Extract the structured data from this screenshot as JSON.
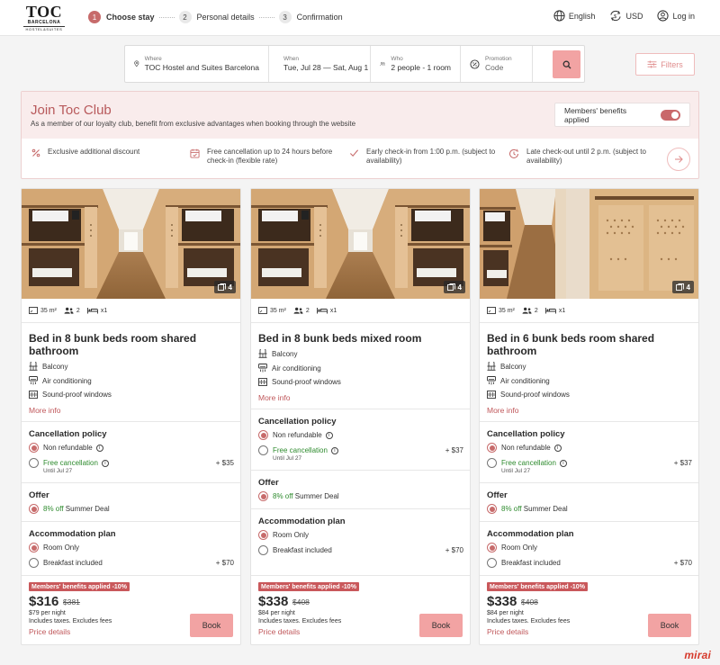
{
  "header": {
    "logo_main": "TOC",
    "logo_city": "BARCELONA",
    "logo_tagline": "HOSTEL&SUITES",
    "steps": [
      {
        "num": "1",
        "label": "Choose stay"
      },
      {
        "num": "2",
        "label": "Personal details"
      },
      {
        "num": "3",
        "label": "Confirmation"
      }
    ],
    "language": "English",
    "currency": "USD",
    "login": "Log in"
  },
  "search": {
    "where_label": "Where",
    "where_value": "TOC Hostel and Suites Barcelona",
    "when_label": "When",
    "when_value": "Tue, Jul 28 — Sat, Aug 1",
    "who_label": "Who",
    "who_value": "2 people - 1 room",
    "promo_label": "Promotion",
    "promo_placeholder": "Code",
    "filters_label": "Filters"
  },
  "club": {
    "title": "Join Toc Club",
    "subtitle": "As a member of our loyalty club, benefit from exclusive advantages when booking through the website",
    "toggle_label": "Members' benefits applied",
    "perks": [
      "Exclusive additional discount",
      "Free cancellation up to 24 hours before check-in (flexible rate)",
      "Early check-in from 1:00 p.m. (subject to availability)",
      "Late check-out until 2 p.m. (subject to availability)"
    ]
  },
  "cards": [
    {
      "photo_count": "4",
      "size": "35 m²",
      "guests": "2",
      "beds": "x1",
      "title": "Bed in 8 bunk beds room shared bathroom",
      "amenities": [
        "Balcony",
        "Air conditioning",
        "Sound-proof windows"
      ],
      "more_info": "More info",
      "cancel_title": "Cancellation policy",
      "non_refundable": "Non refundable",
      "free_cancel": "Free cancellation",
      "free_cancel_until": "Until Jul 27",
      "free_cancel_price": "+ $35",
      "offer_title": "Offer",
      "offer_pct": "8% off",
      "offer_name": "Summer Deal",
      "plan_title": "Accommodation plan",
      "room_only": "Room Only",
      "breakfast": "Breakfast included",
      "breakfast_price": "+ $70",
      "badge": "Members' benefits applied -10%",
      "price": "$316",
      "old_price": "$381",
      "per_night": "$79 per night",
      "taxes": "Includes taxes. Excludes fees",
      "price_details": "Price details",
      "book": "Book"
    },
    {
      "photo_count": "4",
      "size": "35 m²",
      "guests": "2",
      "beds": "x1",
      "title": "Bed in 8 bunk beds mixed room",
      "amenities": [
        "Balcony",
        "Air conditioning",
        "Sound-proof windows"
      ],
      "more_info": "More info",
      "cancel_title": "Cancellation policy",
      "non_refundable": "Non refundable",
      "free_cancel": "Free cancellation",
      "free_cancel_until": "Until Jul 27",
      "free_cancel_price": "+ $37",
      "offer_title": "Offer",
      "offer_pct": "8% off",
      "offer_name": "Summer Deal",
      "plan_title": "Accommodation plan",
      "room_only": "Room Only",
      "breakfast": "Breakfast included",
      "breakfast_price": "+ $70",
      "badge": "Members' benefits applied -10%",
      "price": "$338",
      "old_price": "$408",
      "per_night": "$84 per night",
      "taxes": "Includes taxes. Excludes fees",
      "price_details": "Price details",
      "book": "Book"
    },
    {
      "photo_count": "4",
      "size": "35 m²",
      "guests": "2",
      "beds": "x1",
      "title": "Bed in 6 bunk beds room shared bathroom",
      "amenities": [
        "Balcony",
        "Air conditioning",
        "Sound-proof windows"
      ],
      "more_info": "More info",
      "cancel_title": "Cancellation policy",
      "non_refundable": "Non refundable",
      "free_cancel": "Free cancellation",
      "free_cancel_until": "Until Jul 27",
      "free_cancel_price": "+ $37",
      "offer_title": "Offer",
      "offer_pct": "8% off",
      "offer_name": "Summer Deal",
      "plan_title": "Accommodation plan",
      "room_only": "Room Only",
      "breakfast": "Breakfast included",
      "breakfast_price": "+ $70",
      "badge": "Members' benefits applied -10%",
      "price": "$338",
      "old_price": "$408",
      "per_night": "$84 per night",
      "taxes": "Includes taxes. Excludes fees",
      "price_details": "Price details",
      "book": "Book"
    }
  ],
  "footer": {
    "brand": "mirai"
  },
  "colors": {
    "accent": "#c76b6b",
    "button": "#f2a3a3",
    "link": "#c0585b",
    "green": "#2e8b2e"
  }
}
